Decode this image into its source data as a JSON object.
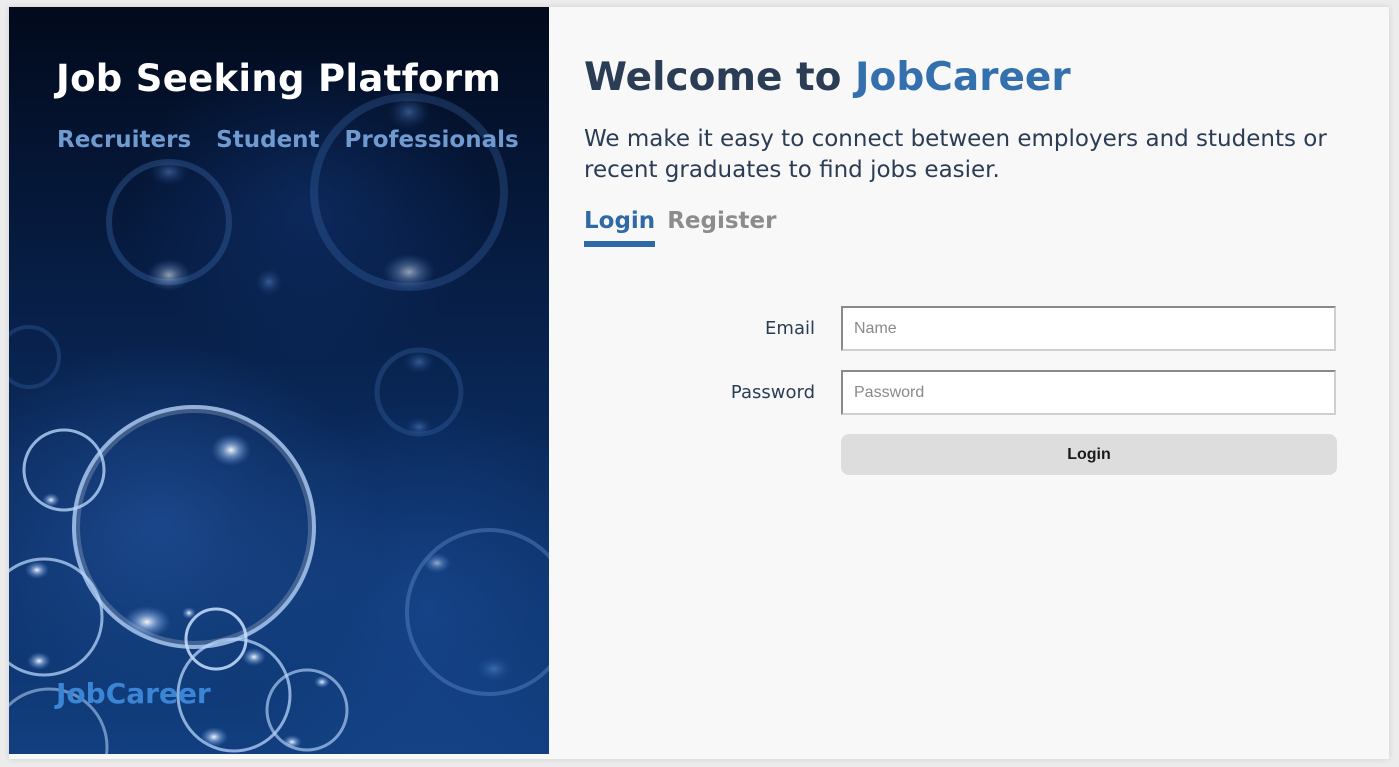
{
  "sidebar": {
    "title": "Job Seeking Platform",
    "nav": [
      {
        "label": "Recruiters"
      },
      {
        "label": "Student"
      },
      {
        "label": "Professionals"
      }
    ],
    "brand": "JobCareer"
  },
  "main": {
    "welcome_prefix": "Welcome to ",
    "welcome_brand": "JobCareer",
    "intro": "We make it easy to connect between employers and students or recent graduates to find jobs easier.",
    "tabs": [
      {
        "label": "Login",
        "active": true
      },
      {
        "label": "Register",
        "active": false
      }
    ],
    "form": {
      "email_label": "Email",
      "email_placeholder": "Name",
      "email_value": "",
      "password_label": "Password",
      "password_placeholder": "Password",
      "password_value": "",
      "submit_label": "Login"
    }
  },
  "colors": {
    "accent": "#2f6aa7",
    "heading": "#2b3d55",
    "nav_link": "#6f9bd1",
    "brand_link": "#3a85d6"
  }
}
